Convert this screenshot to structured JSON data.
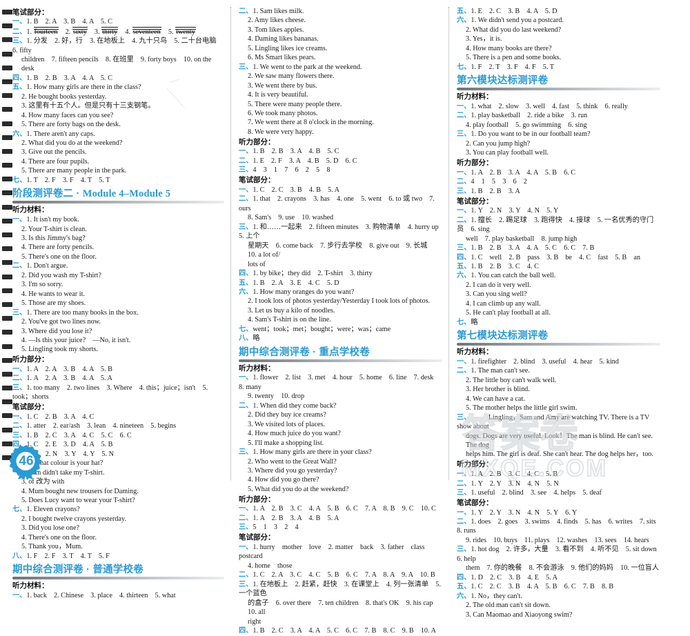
{
  "page": {
    "number": "46",
    "watermark_cn": "答案卷",
    "watermark_url": "MXQE.COM"
  },
  "columns": [
    {
      "id": "col-1",
      "blocks": [
        {
          "type": "subhead",
          "text": "笔试部分："
        },
        {
          "type": "item",
          "num": "一、",
          "text": "1. B　2. A　3. B　4. A　5. C"
        },
        {
          "type": "strike-item",
          "num": "二、",
          "prefix": "1. ",
          "words": [
            "fourteen",
            "sixty",
            "thirty",
            "seventeen",
            "twenty"
          ]
        },
        {
          "type": "item",
          "num": "三、",
          "text": "1. 分发　2. 好，行　3. 在地板上　4. 九十只鸟　5. 二十台电脑　6. fifty"
        },
        {
          "type": "cont",
          "text": "children　7. fifteen pencils　8. 在班里　9. forty boys　10. on the desk"
        },
        {
          "type": "item",
          "num": "四、",
          "text": "1. B　2. B　3. A　4. A　5. C"
        },
        {
          "type": "item",
          "num": "五、",
          "text": "1. How many girls are there in the class?"
        },
        {
          "type": "sub",
          "text": "2. He bought books yesterday."
        },
        {
          "type": "sub",
          "text": "3. 这里有十五个人。但是只有十三支钢笔。"
        },
        {
          "type": "sub",
          "text": "4. How many faces can you see?"
        },
        {
          "type": "sub",
          "text": "5. There are forty bags on the desk."
        },
        {
          "type": "item",
          "num": "六、",
          "text": "1. There aren't any caps."
        },
        {
          "type": "sub",
          "text": "2. What did you do at the weekend?"
        },
        {
          "type": "sub",
          "text": "3. Give out the pencils."
        },
        {
          "type": "sub",
          "text": "4. There are four pupils."
        },
        {
          "type": "sub",
          "text": "5. There are many people in the park."
        },
        {
          "type": "item",
          "num": "七、",
          "text": "1. T　2. F　3. F　4. T　5. T"
        },
        {
          "type": "title",
          "cn": "阶段测评卷二",
          "dot": "·",
          "mod": "Module 4–Module 5"
        },
        {
          "type": "subhead",
          "text": "听力材料："
        },
        {
          "type": "item",
          "num": "一、",
          "text": "1. It isn't my book."
        },
        {
          "type": "sub",
          "text": "2. Your T-shirt is clean."
        },
        {
          "type": "sub",
          "text": "3. Is this Jimmy's bag?"
        },
        {
          "type": "sub",
          "text": "4. There are forty pencils."
        },
        {
          "type": "sub",
          "text": "5. There's one on the floor."
        },
        {
          "type": "item",
          "num": "二、",
          "text": "1. Don't argue."
        },
        {
          "type": "sub",
          "text": "2. Did you wash my T-shirt?"
        },
        {
          "type": "sub",
          "text": "3. I'm so sorry."
        },
        {
          "type": "sub",
          "text": "4. He wants to wear it."
        },
        {
          "type": "sub",
          "text": "5. Those are my shoes."
        },
        {
          "type": "item",
          "num": "三、",
          "text": "1. There are too many books in the box."
        },
        {
          "type": "sub",
          "text": "2. You've got two lines now."
        },
        {
          "type": "sub",
          "text": "3. Where did you lose it?"
        },
        {
          "type": "sub",
          "text": "4. —Is this your juice?　—No, it isn't."
        },
        {
          "type": "sub",
          "text": "5. Lingling took my shorts."
        },
        {
          "type": "subhead",
          "text": "听力部分："
        },
        {
          "type": "item",
          "num": "一、",
          "text": "1. A　2. A　3. B　4. A　5. B"
        },
        {
          "type": "item",
          "num": "二、",
          "text": "1. A　2. A　3. B　4. A　5. A"
        },
        {
          "type": "item",
          "num": "三、",
          "text": "1. too many　2. two lines　3. Where　4. this；juice；isn't　5. took；shorts"
        },
        {
          "type": "subhead",
          "text": "笔试部分："
        },
        {
          "type": "item",
          "num": "一、",
          "text": "1. C　2. B　3. A　4. C"
        },
        {
          "type": "item",
          "num": "二、",
          "text": "1. atter　2. ear/ash　3. lean　4. nineteen　5. begins"
        },
        {
          "type": "item",
          "num": "三、",
          "text": "1. B　2. C　3. A　4. C　5. C　6. C"
        },
        {
          "type": "item",
          "num": "四、",
          "text": "1. C　2. E　3. D　4. A　5. B"
        },
        {
          "type": "item",
          "num": "五、",
          "text": "1. Y　2. N　3. Y　4. Y　5. N"
        },
        {
          "type": "item",
          "num": "六、",
          "text": "1. What colour is your hat?"
        },
        {
          "type": "sub",
          "text": "2. Sam didn't take my T-shirt."
        },
        {
          "type": "sub",
          "text": "3. of 改为 with"
        },
        {
          "type": "sub",
          "text": "4. Mum bought new trousers for Daming."
        },
        {
          "type": "sub",
          "text": "5. Does Lucy want to wear your T-shirt?"
        },
        {
          "type": "item",
          "num": "七、",
          "text": "1. Eleven crayons?"
        },
        {
          "type": "sub",
          "text": "2. I bought twelve crayons yesterday."
        },
        {
          "type": "sub",
          "text": "3. Did you lose one?"
        },
        {
          "type": "sub",
          "text": "4. There's one on the floor."
        },
        {
          "type": "sub",
          "text": "5. Thank you，Mum."
        },
        {
          "type": "item",
          "num": "八、",
          "text": "1. F　2. F　3. T　4. T　5. F"
        },
        {
          "type": "title",
          "cn": "期中综合测评卷",
          "dot": "·",
          "mod2": "普通学校卷"
        },
        {
          "type": "subhead",
          "text": "听力材料："
        },
        {
          "type": "item",
          "num": "一、",
          "text": "1. back　2. Chinese　3. place　4. thirteen　5. what"
        }
      ]
    },
    {
      "id": "col-2",
      "blocks": [
        {
          "type": "item",
          "num": "二、",
          "text": "1. Sam likes milk."
        },
        {
          "type": "sub",
          "text": "2. Amy likes cheese."
        },
        {
          "type": "sub",
          "text": "3. Tom likes apples."
        },
        {
          "type": "sub",
          "text": "4. Daming likes bananas."
        },
        {
          "type": "sub",
          "text": "5. Lingling likes ice creams."
        },
        {
          "type": "sub",
          "text": "6. Ms Smart likes pears."
        },
        {
          "type": "item",
          "num": "三、",
          "text": "1. We went to the park at the weekend."
        },
        {
          "type": "sub",
          "text": "2. We saw many flowers there."
        },
        {
          "type": "sub",
          "text": "3. We went there by bus."
        },
        {
          "type": "sub",
          "text": "4. It is very beautiful."
        },
        {
          "type": "sub",
          "text": "5. There were many people there."
        },
        {
          "type": "sub",
          "text": "6. We took many photos."
        },
        {
          "type": "sub",
          "text": "7. We went there at 8 o'clock in the morning."
        },
        {
          "type": "sub",
          "text": "8. We were very happy."
        },
        {
          "type": "subhead",
          "text": "听力部分："
        },
        {
          "type": "item",
          "num": "一、",
          "text": "1. B　2. B　3. A　4. B　5. C"
        },
        {
          "type": "item",
          "num": "二、",
          "text": "1. E　2. F　3. A　4. B　5. D　6. C"
        },
        {
          "type": "item",
          "num": "三、",
          "text": "4　3　1　7　6　2　5　8"
        },
        {
          "type": "subhead",
          "text": "笔试部分："
        },
        {
          "type": "item",
          "num": "一、",
          "text": "1. C　2. C　3. B　4. B　5. A"
        },
        {
          "type": "item",
          "num": "二、",
          "text": "1. that　2. crayons　3. has　4. one　5. went　6. to 或 two　7. ours"
        },
        {
          "type": "cont",
          "text": "8. Sam's　9. use　10. washed"
        },
        {
          "type": "item",
          "num": "三、",
          "text": "1. 和……一起来　2. fifteen minutes　3. 购物清单　4. hurry up　5. 上个"
        },
        {
          "type": "cont",
          "text": "星期天　6. come back　7. 步行去学校　8. give out　9. 长城　10. a lot of/"
        },
        {
          "type": "cont",
          "text": "lots of"
        },
        {
          "type": "item",
          "num": "四、",
          "text": "1. by bike；they did　2. T-shirt　3. thirty"
        },
        {
          "type": "item",
          "num": "五、",
          "text": "1. B　2. A　3. E　4. C　5. D"
        },
        {
          "type": "item",
          "num": "六、",
          "text": "1. How many oranges do you want?"
        },
        {
          "type": "sub",
          "text": "2. I took lots of photos yesterday/Yesterday I took lots of photos."
        },
        {
          "type": "sub",
          "text": "3. Let us buy a kilo of noodles."
        },
        {
          "type": "sub",
          "text": "4. Sam's T-shirt is on the line."
        },
        {
          "type": "item",
          "num": "七、",
          "text": "went；took；met；bought；were；was；came"
        },
        {
          "type": "item",
          "num": "八、",
          "text": "略"
        },
        {
          "type": "title",
          "cn": "期中综合测评卷",
          "dot": "·",
          "mod2": "重点学校卷"
        },
        {
          "type": "subhead",
          "text": "听力材料："
        },
        {
          "type": "item",
          "num": "一、",
          "text": "1. flower　2. list　3. met　4. hour　5. home　6. line　7. desk　8. many"
        },
        {
          "type": "cont",
          "text": "9. twenty　10. drop"
        },
        {
          "type": "item",
          "num": "二、",
          "text": "1. When did they come back?"
        },
        {
          "type": "sub",
          "text": "2. Did they buy ice creams?"
        },
        {
          "type": "sub",
          "text": "3. We visited lots of places."
        },
        {
          "type": "sub",
          "text": "4. How much juice do you want?"
        },
        {
          "type": "sub",
          "text": "5. I'll make a shopping list."
        },
        {
          "type": "item",
          "num": "三、",
          "text": "1. How many girls are there in your class?"
        },
        {
          "type": "sub",
          "text": "2. Who went to the Great Wall?"
        },
        {
          "type": "sub",
          "text": "3. Where did you go yesterday?"
        },
        {
          "type": "sub",
          "text": "4. How did you go there?"
        },
        {
          "type": "sub",
          "text": "5. What did you do at the weekend?"
        },
        {
          "type": "subhead",
          "text": "听力部分："
        },
        {
          "type": "item",
          "num": "一、",
          "text": "1. A　2. B　3. C　4. A　5. B　6. C　7. A　8. B　9. C　10. C"
        },
        {
          "type": "item",
          "num": "二、",
          "text": "1. A　2. B　3. A　4. B　5. A"
        },
        {
          "type": "item",
          "num": "三、",
          "text": "5　1　3　2　4"
        },
        {
          "type": "subhead",
          "text": "笔试部分："
        },
        {
          "type": "item",
          "num": "一、",
          "text": "1. hurry　mother　love　2. matter　back　3. father　class　postcard"
        },
        {
          "type": "cont",
          "text": "4. home　those"
        },
        {
          "type": "item",
          "num": "二、",
          "text": "1. C　2. A　3. C　4. C　5. B　6. C　7. A　8. A　9. A　10. B"
        },
        {
          "type": "item",
          "num": "三、",
          "text": "1. 在地板上　2. 赶紧，赶快　3. 在课堂上　4. 列一张清单　5. 一个蓝色"
        },
        {
          "type": "cont",
          "text": "的盒子　6. over there　7. ten children　8. that's OK　9. his cap　10. all"
        },
        {
          "type": "cont",
          "text": "right"
        },
        {
          "type": "item",
          "num": "四、",
          "text": "1. B　2. C　3. A　4. A　5. C　6. C　7. B　8. C　9. B　10. A"
        }
      ]
    },
    {
      "id": "col-3",
      "blocks": [
        {
          "type": "item",
          "num": "五、",
          "text": "1. E　2. C　3. B　4. A　5. D"
        },
        {
          "type": "item",
          "num": "六、",
          "text": "1. We didn't send you a postcard."
        },
        {
          "type": "sub",
          "text": "2. What did you do last weekend?"
        },
        {
          "type": "sub",
          "text": "3. Yes，it is."
        },
        {
          "type": "sub",
          "text": "4. How many books are there?"
        },
        {
          "type": "sub",
          "text": "5. There is a pen and some books."
        },
        {
          "type": "item",
          "num": "七、",
          "text": "1. F　2. T　3. F　4. F　5. T"
        },
        {
          "type": "title",
          "cn": "第六模块达标测评卷"
        },
        {
          "type": "subhead",
          "text": "听力材料："
        },
        {
          "type": "item",
          "num": "一、",
          "text": "1. what　2. slow　3. well　4. fast　5. think　6. really"
        },
        {
          "type": "item",
          "num": "二、",
          "text": "1. play basketball　2. ride a bike　3. run"
        },
        {
          "type": "cont",
          "text": "4. play football　5. go swimming　6. sing"
        },
        {
          "type": "item",
          "num": "三、",
          "text": "1. Do you want to be in our football team?"
        },
        {
          "type": "sub",
          "text": "2. Can you jump high?"
        },
        {
          "type": "sub",
          "text": "3. You can play football well."
        },
        {
          "type": "subhead",
          "text": "听力部分："
        },
        {
          "type": "item",
          "num": "一、",
          "text": "1. A　2. B　3. A　4. A　5. B　6. C"
        },
        {
          "type": "item",
          "num": "二、",
          "text": "4　1　5　3　6　2"
        },
        {
          "type": "item",
          "num": "三、",
          "text": "1. B　2. B　3. A"
        },
        {
          "type": "subhead",
          "text": "笔试部分："
        },
        {
          "type": "item",
          "num": "一、",
          "text": "1. Y　2. N　3. Y　4. N　5. Y"
        },
        {
          "type": "item",
          "num": "二、",
          "text": "1. 擅长　2. 踢足球　3. 跑得快　4. 接球　5. 一名优秀的守门员　6. sing"
        },
        {
          "type": "cont",
          "text": "well　7. play basketball　8. jump high"
        },
        {
          "type": "item",
          "num": "三、",
          "text": "1. B　2. B　3. A　4. A　5. C　6. C　7. B"
        },
        {
          "type": "item",
          "num": "四、",
          "text": "1. C　well　2. B　pass　3. B　be　4. C　fast　5. B　an"
        },
        {
          "type": "item",
          "num": "五、",
          "text": "1. B　2. B　3. C　4. C"
        },
        {
          "type": "item",
          "num": "六、",
          "text": "1. You can catch the ball well."
        },
        {
          "type": "sub",
          "text": "2. I can do it very well."
        },
        {
          "type": "sub",
          "text": "3. Can you sing well?"
        },
        {
          "type": "sub",
          "text": "4. I can climb up any wall."
        },
        {
          "type": "sub",
          "text": "5. He can't play football at all."
        },
        {
          "type": "item",
          "num": "七、",
          "text": "略"
        },
        {
          "type": "title",
          "cn": "第七模块达标测评卷"
        },
        {
          "type": "subhead",
          "text": "听力材料："
        },
        {
          "type": "item",
          "num": "一、",
          "text": "1. firefighter　2. blind　3. useful　4. hear　5. kind"
        },
        {
          "type": "item",
          "num": "二、",
          "text": "1. The man can't see."
        },
        {
          "type": "sub",
          "text": "2. The little boy can't walk well."
        },
        {
          "type": "sub",
          "text": "3. Her brother is blind."
        },
        {
          "type": "sub",
          "text": "4. We can have a cat."
        },
        {
          "type": "sub",
          "text": "5. The mother helps the little girl swim."
        },
        {
          "type": "item",
          "num": "三、",
          "text": "　　　Lingling，Sam and Amy are watching TV. There is a TV show about"
        },
        {
          "type": "cont",
          "text": "dogs. Dogs are very useful. Look！The man is blind. He can't see. The dog"
        },
        {
          "type": "cont",
          "text": "helps him. The girl is deaf. She can't hear. The dog helps her，too."
        },
        {
          "type": "subhead",
          "text": "听力部分："
        },
        {
          "type": "item",
          "num": "一、",
          "text": "1. A　2. B　3. C　4. C　5. B"
        },
        {
          "type": "item",
          "num": "二、",
          "text": "1. Y　2. Y　3. N　4. N　5. N"
        },
        {
          "type": "item",
          "num": "三、",
          "text": "1. useful　2. blind　3. see　4. helps　5. deaf"
        },
        {
          "type": "subhead",
          "text": "笔试部分："
        },
        {
          "type": "item",
          "num": "一、",
          "text": "1. Y　2. Y　3. N　4. N　5. Y　6. Y"
        },
        {
          "type": "item",
          "num": "二、",
          "text": "1. does　2. goes　3. swims　4. finds　5. has　6. writes　7. sits　8. runs"
        },
        {
          "type": "cont",
          "text": "9. rides　10. buys　11. plays　12. washes　13. sees　14. hears"
        },
        {
          "type": "item",
          "num": "三、",
          "text": "1. hot dog　2. 许多，大量　3. 看不到　4. 听不见　5. sit down　6. help"
        },
        {
          "type": "cont",
          "text": "them　7. 你的晚餐　8. 不会游泳　9. 他们的妈妈　10. 一位盲人"
        },
        {
          "type": "item",
          "num": "四、",
          "text": "1. D　2. C　3. B　4. E　5. A"
        },
        {
          "type": "item",
          "num": "五、",
          "text": "1. C　2. C　3. B　4. A　5. B　6. C　7. B　8. B"
        },
        {
          "type": "item",
          "num": "六、",
          "text": "1. No，they can't."
        },
        {
          "type": "sub",
          "text": "2. The old man can't sit down."
        },
        {
          "type": "sub",
          "text": "3. Can Maomao and Xiaoyong swim?"
        }
      ]
    }
  ]
}
